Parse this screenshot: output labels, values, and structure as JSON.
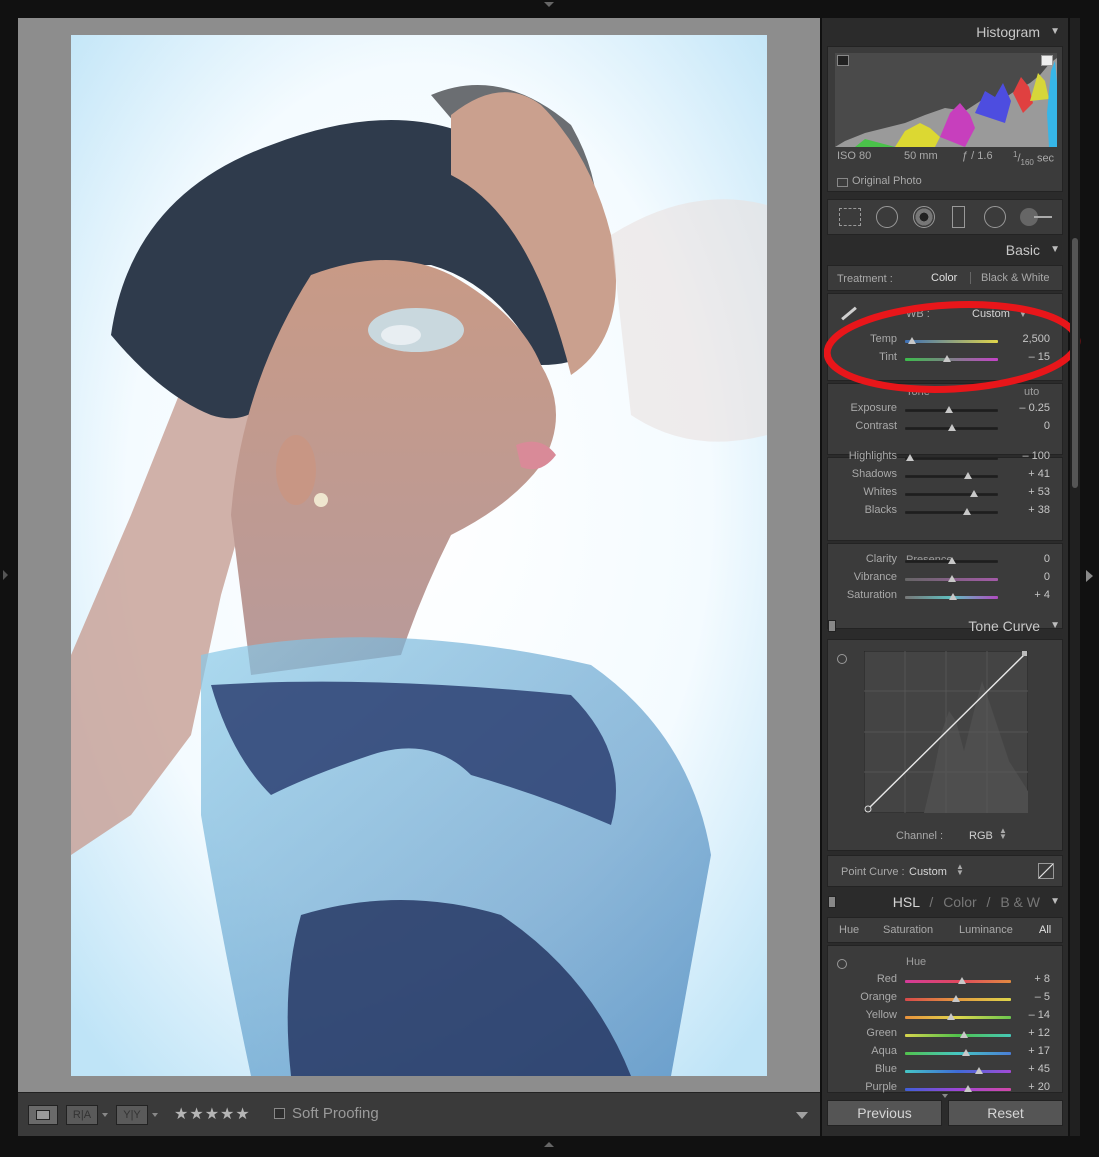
{
  "toolbar": {
    "loupe_icon": "loupe-view-icon",
    "before_after_lr": "R|A",
    "before_after_tb": "Y|Y",
    "stars": "★★★★★",
    "soft_proofing": "Soft Proofing"
  },
  "histogram": {
    "title": "Histogram",
    "iso": "ISO 80",
    "focal": "50 mm",
    "aperture": "ƒ / 1.6",
    "shutter_num": "1",
    "shutter_den": "160",
    "shutter_unit": "sec",
    "original_photo": "Original Photo"
  },
  "basic": {
    "title": "Basic",
    "treatment_label": "Treatment :",
    "treatment_color": "Color",
    "treatment_bw": "Black & White",
    "wb_label": "WB :",
    "wb_value": "Custom",
    "tone_label": "Tone",
    "auto_label": "uto",
    "presence_label": "Presence",
    "sliders": [
      {
        "name": "Temp",
        "value": "2,500",
        "pos": 0.08
      },
      {
        "name": "Tint",
        "value": "– 15",
        "pos": 0.45
      },
      {
        "name": "Exposure",
        "value": "– 0.25",
        "pos": 0.47
      },
      {
        "name": "Contrast",
        "value": "0",
        "pos": 0.5
      },
      {
        "name": "Highlights",
        "value": "– 100",
        "pos": 0.05
      },
      {
        "name": "Shadows",
        "value": "+ 41",
        "pos": 0.68
      },
      {
        "name": "Whites",
        "value": "+ 53",
        "pos": 0.74
      },
      {
        "name": "Blacks",
        "value": "+ 38",
        "pos": 0.67
      },
      {
        "name": "Clarity",
        "value": "0",
        "pos": 0.5
      },
      {
        "name": "Vibrance",
        "value": "0",
        "pos": 0.5
      },
      {
        "name": "Saturation",
        "value": "+ 4",
        "pos": 0.52
      }
    ]
  },
  "tone_curve": {
    "title": "Tone Curve",
    "channel_label": "Channel :",
    "channel_value": "RGB",
    "point_curve_label": "Point Curve :",
    "point_curve_value": "Custom"
  },
  "hsl": {
    "title_hsl": "HSL",
    "title_color": "Color",
    "title_bw": "B & W",
    "sep": "/",
    "tabs": [
      "Hue",
      "Saturation",
      "Luminance",
      "All"
    ],
    "section": "Hue",
    "sliders": [
      {
        "name": "Red",
        "value": "+ 8",
        "pos": 0.54
      },
      {
        "name": "Orange",
        "value": "– 5",
        "pos": 0.48
      },
      {
        "name": "Yellow",
        "value": "– 14",
        "pos": 0.43
      },
      {
        "name": "Green",
        "value": "+ 12",
        "pos": 0.56
      },
      {
        "name": "Aqua",
        "value": "+ 17",
        "pos": 0.58
      },
      {
        "name": "Blue",
        "value": "+ 45",
        "pos": 0.7
      },
      {
        "name": "Purple",
        "value": "+ 20",
        "pos": 0.59
      }
    ]
  },
  "buttons": {
    "previous": "Previous",
    "reset": "Reset"
  },
  "colors": {
    "annotation_circle": "#e8161a",
    "panel_bg": "#2b2b2b"
  }
}
